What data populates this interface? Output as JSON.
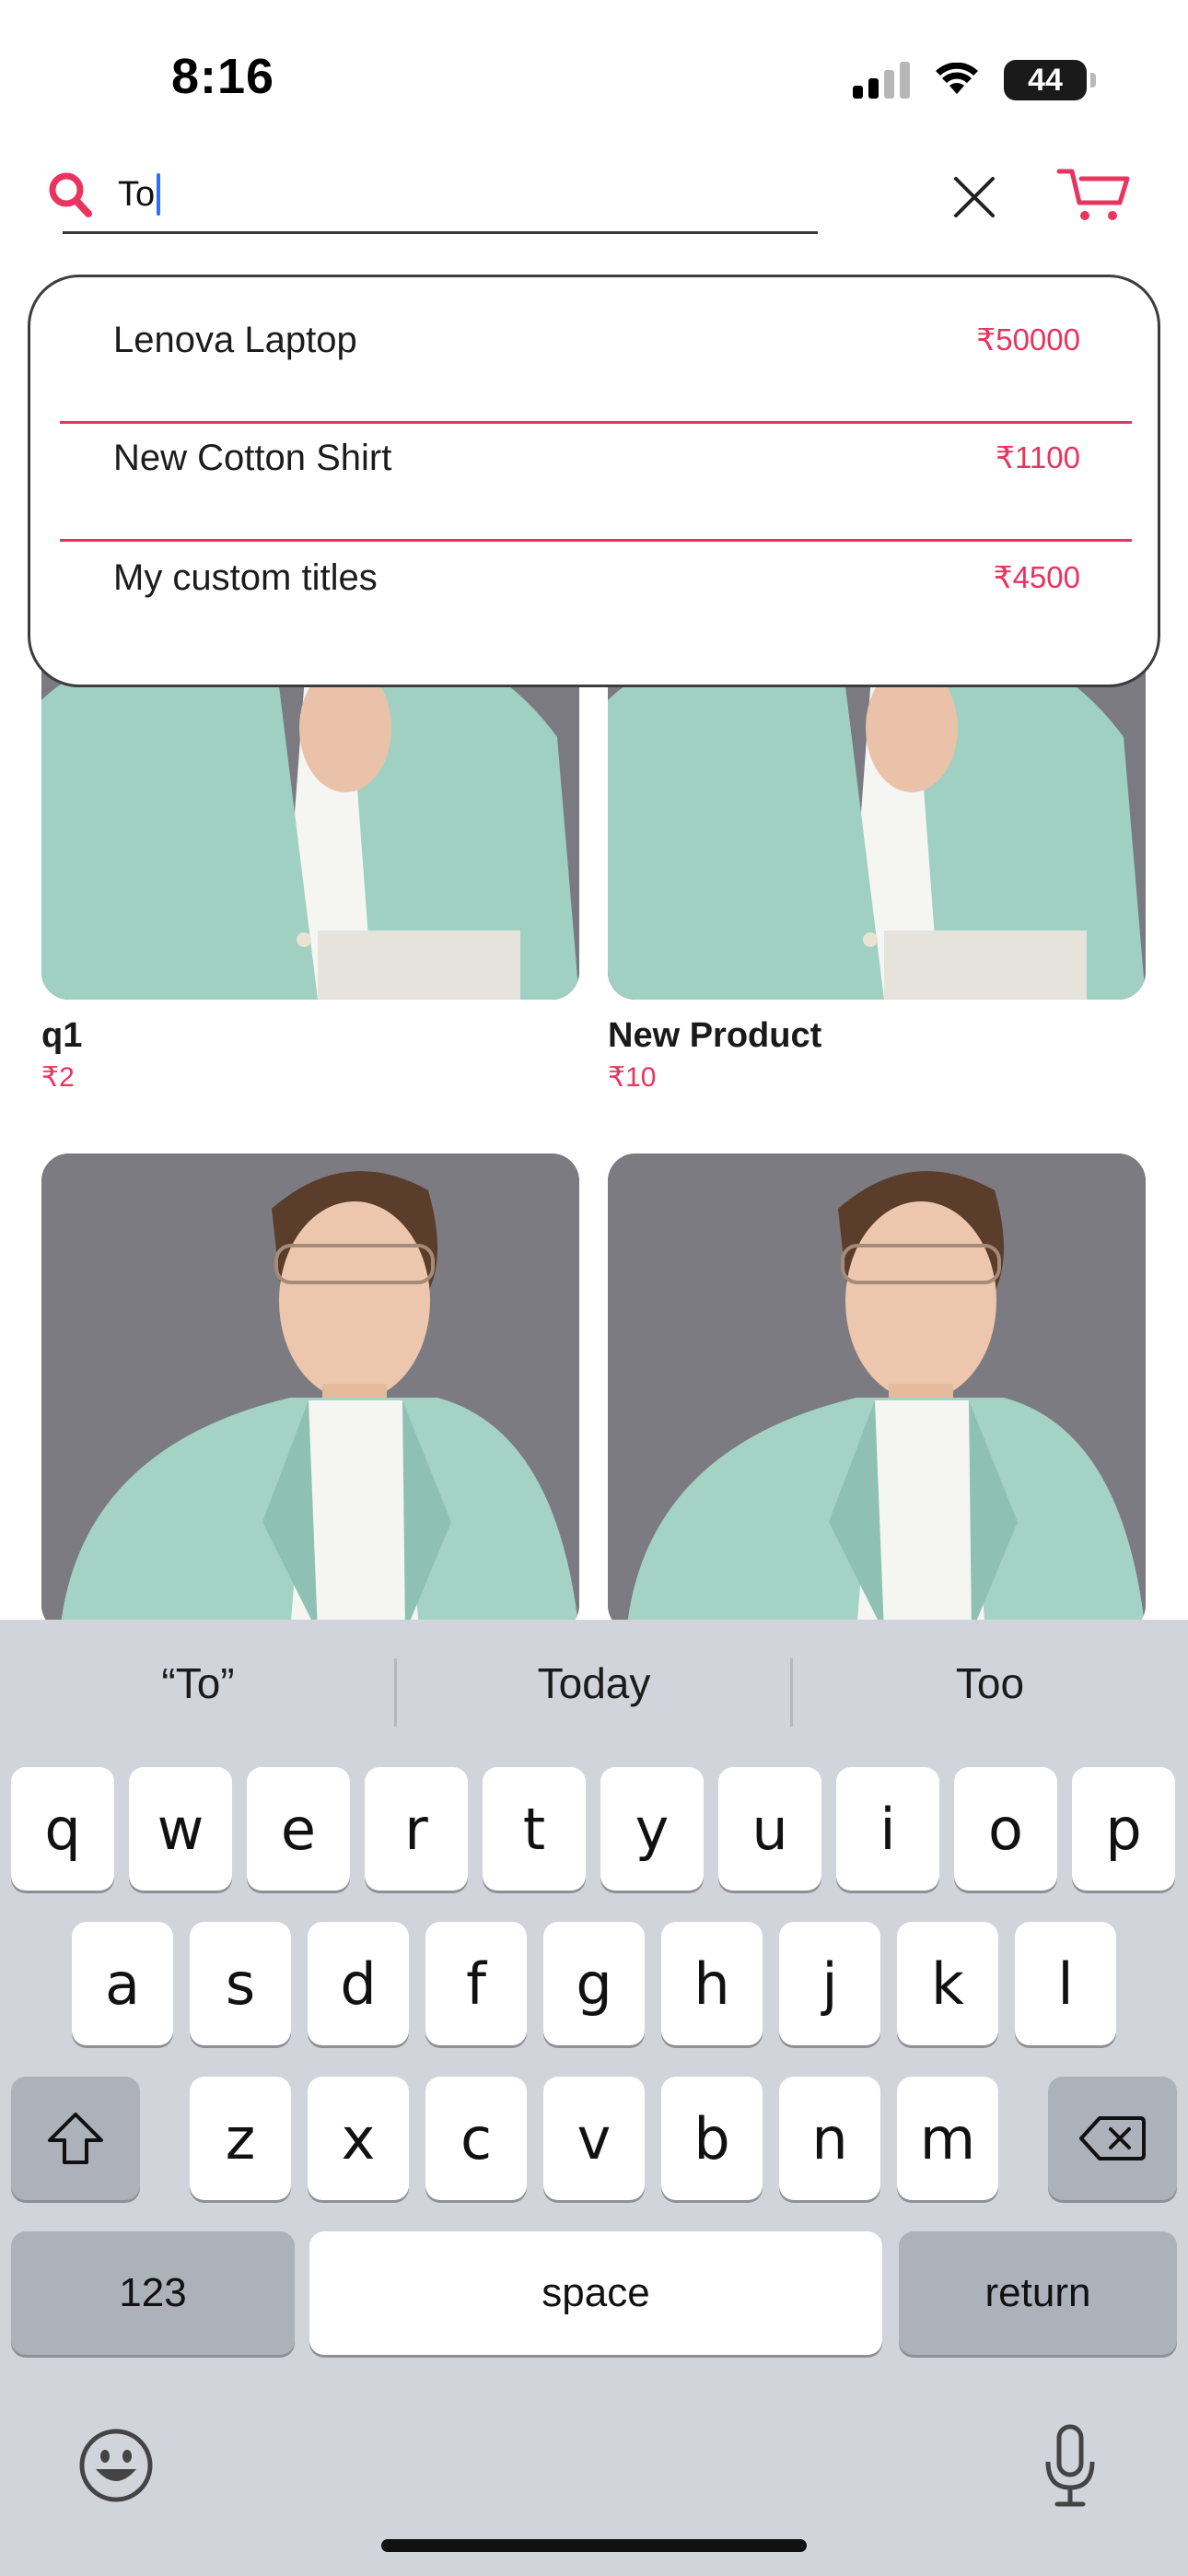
{
  "status_bar": {
    "time": "8:16",
    "battery_level": "44"
  },
  "search": {
    "value": "To",
    "accent_color": "#e8345f"
  },
  "suggestions": [
    {
      "name": "Lenova Laptop",
      "price": "₹50000"
    },
    {
      "name": "New Cotton Shirt",
      "price": "₹1100"
    },
    {
      "name": "My custom titles",
      "price": "₹4500"
    }
  ],
  "products": [
    {
      "name": "q1",
      "price": "₹2"
    },
    {
      "name": "New Product",
      "price": "₹10"
    },
    {
      "name": "",
      "price": ""
    },
    {
      "name": "",
      "price": ""
    }
  ],
  "keyboard": {
    "predictions": [
      "“To”",
      "Today",
      "Too"
    ],
    "row1": [
      "q",
      "w",
      "e",
      "r",
      "t",
      "y",
      "u",
      "i",
      "o",
      "p"
    ],
    "row2": [
      "a",
      "s",
      "d",
      "f",
      "g",
      "h",
      "j",
      "k",
      "l"
    ],
    "row3": [
      "z",
      "x",
      "c",
      "v",
      "b",
      "n",
      "m"
    ],
    "numbers_label": "123",
    "space_label": "space",
    "return_label": "return"
  },
  "icons": {
    "search": "search-icon",
    "clear": "close-icon",
    "cart": "cart-icon",
    "shift": "shift-icon",
    "backspace": "backspace-icon",
    "emoji": "emoji-icon",
    "mic": "microphone-icon"
  }
}
